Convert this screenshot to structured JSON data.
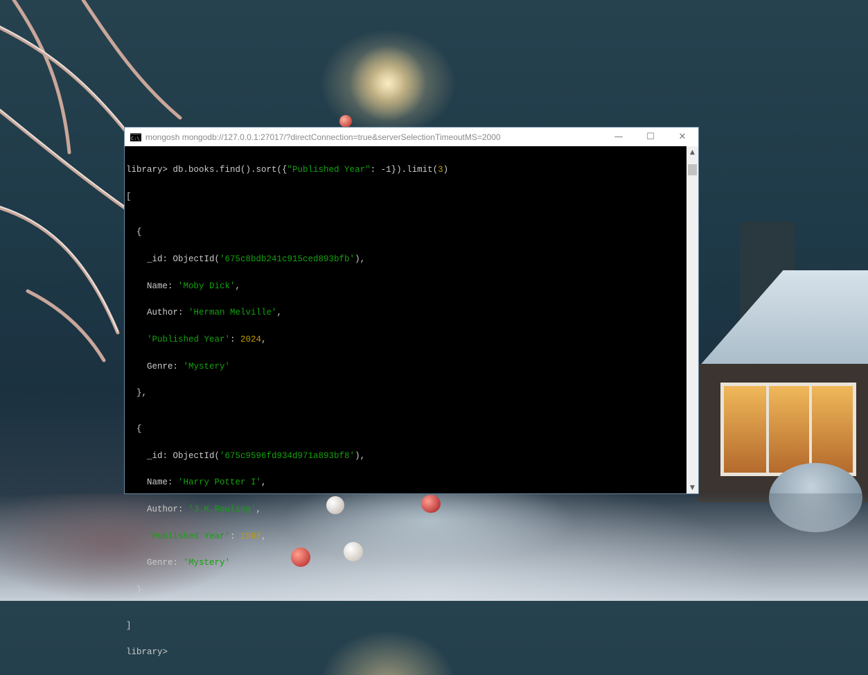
{
  "window": {
    "title": "mongosh mongodb://127.0.0.1:27017/?directConnection=true&serverSelectionTimeoutMS=2000",
    "icon": "console-app-icon",
    "icon_text": "C:\\",
    "minimize_glyph": "—",
    "maximize_glyph": "☐",
    "close_glyph": "✕"
  },
  "scrollbar": {
    "up_glyph": "▲",
    "down_glyph": "▼"
  },
  "terminal": {
    "command_prompt": "library> ",
    "command_pre": "db.books.find().sort({",
    "command_key": "\"Published Year\"",
    "command_mid": ": -1}).limit(",
    "command_num": "3",
    "command_post": ")",
    "open_bracket": "[",
    "close_bracket": "]",
    "records": [
      {
        "open": "  {",
        "id_prefix": "    _id: ObjectId(",
        "id_value": "'675c8bdb241c915ced893bfb'",
        "id_suffix": "),",
        "name_key": "    Name: ",
        "name_value": "'Moby Dick'",
        "author_key": "    Author: ",
        "author_value": "'Herman Melville'",
        "year_key": "    'Published Year'",
        "year_sep": ": ",
        "year_value": "2024",
        "genre_key": "    Genre: ",
        "genre_value": "'Mystery'",
        "close": "  },"
      },
      {
        "open": "  {",
        "id_prefix": "    _id: ObjectId(",
        "id_value": "'675c9596fd934d971a893bf8'",
        "id_suffix": "),",
        "name_key": "    Name: ",
        "name_value": "'Harry Potter I'",
        "author_key": "    Author: ",
        "author_value": "'J.K.Rowling'",
        "year_key": "    'Published Year'",
        "year_sep": ": ",
        "year_value": "1997",
        "genre_key": "    Genre: ",
        "genre_value": "'Mystery'",
        "close": "  }"
      }
    ],
    "final_prompt": "library> "
  },
  "colors": {
    "string": "#13a10e",
    "number": "#c19c00",
    "text": "#cccccc",
    "background": "#000000"
  }
}
